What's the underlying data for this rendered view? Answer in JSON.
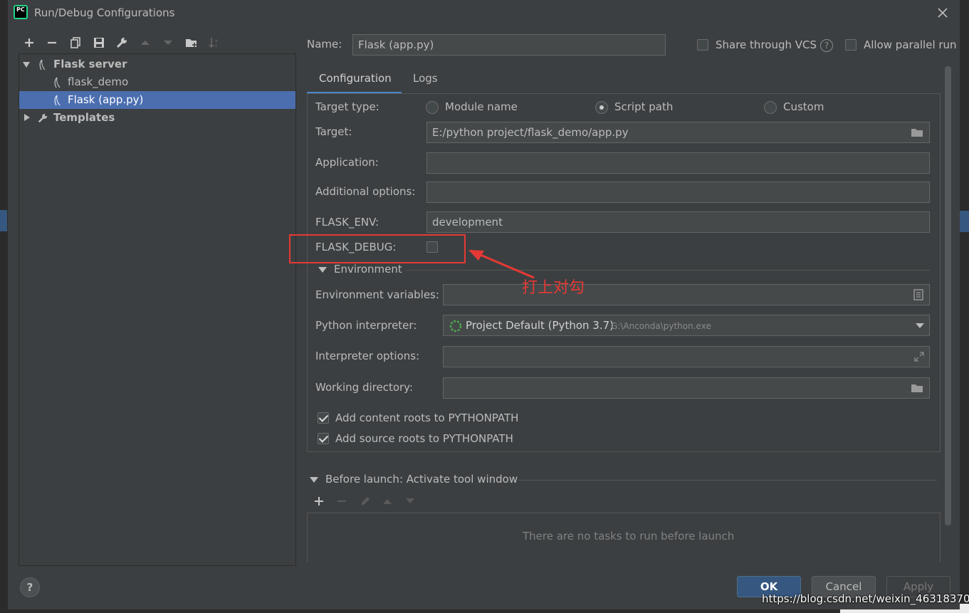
{
  "window": {
    "title": "Run/Debug Configurations",
    "app_icon_text": "PC"
  },
  "toolbar": {
    "icons": [
      "add-icon",
      "remove-icon",
      "copy-icon",
      "save-icon",
      "wrench-icon",
      "move-up-icon",
      "move-down-icon",
      "new-folder-icon",
      "sort-icon"
    ]
  },
  "tree": {
    "group_label": "Flask server",
    "items": [
      {
        "label": "flask_demo"
      },
      {
        "label": "Flask (app.py)"
      }
    ],
    "templates_label": "Templates"
  },
  "header": {
    "name_label": "Name:",
    "name_value": "Flask (app.py)",
    "share_vcs_label": "Share through VCS",
    "allow_parallel_label": "Allow parallel run"
  },
  "tabs": [
    {
      "label": "Configuration",
      "active": true
    },
    {
      "label": "Logs",
      "active": false
    }
  ],
  "config": {
    "target_type_label": "Target type:",
    "target_type_options": [
      "Module name",
      "Script path",
      "Custom"
    ],
    "target_type_selected": "Script path",
    "target_label": "Target:",
    "target_value": "E:/python project/flask_demo/app.py",
    "application_label": "Application:",
    "application_value": "",
    "additional_options_label": "Additional options:",
    "additional_options_value": "",
    "flask_env_label": "FLASK_ENV:",
    "flask_env_value": "development",
    "flask_debug_label": "FLASK_DEBUG:",
    "flask_debug_checked": false,
    "environment_section": "Environment",
    "env_vars_label": "Environment variables:",
    "env_vars_value": "",
    "python_interpreter_label": "Python interpreter:",
    "python_interpreter_value": "Project Default (Python 3.7)",
    "python_interpreter_path": "G:\\Anconda\\python.exe",
    "interpreter_options_label": "Interpreter options:",
    "interpreter_options_value": "",
    "working_directory_label": "Working directory:",
    "working_directory_value": "",
    "add_content_roots_label": "Add content roots to PYTHONPATH",
    "add_content_roots_checked": true,
    "add_source_roots_label": "Add source roots to PYTHONPATH",
    "add_source_roots_checked": true
  },
  "before_launch": {
    "label": "Before launch: Activate tool window",
    "empty_text": "There are no tasks to run before launch"
  },
  "buttons": {
    "ok": "OK",
    "cancel": "Cancel",
    "apply": "Apply",
    "help": "?"
  },
  "annotation": {
    "text": "打上对勾",
    "color": "#e53935"
  },
  "watermark": "https://blog.csdn.net/weixin_46318370",
  "colors": {
    "dialog_bg": "#3c3f41",
    "selection": "#4b6eaf",
    "accent": "#4a88c7",
    "ok_button": "#365880"
  }
}
